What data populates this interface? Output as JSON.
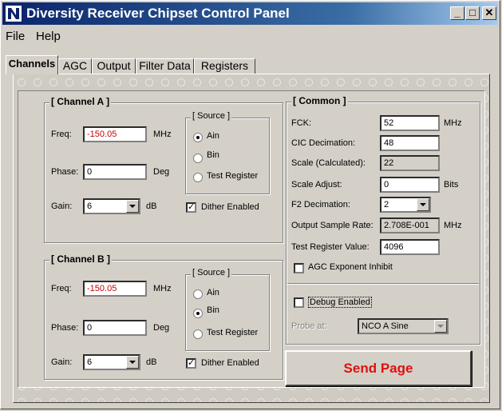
{
  "window": {
    "title": "Diversity Receiver Chipset Control Panel"
  },
  "menu": {
    "file": "File",
    "help": "Help"
  },
  "tabs": [
    "Channels",
    "AGC",
    "Output",
    "Filter Data",
    "Registers"
  ],
  "channel_a": {
    "title": "[ Channel A ]",
    "freq_label": "Freq:",
    "freq_value": "-150.05",
    "freq_unit": "MHz",
    "phase_label": "Phase:",
    "phase_value": "0",
    "phase_unit": "Deg",
    "gain_label": "Gain:",
    "gain_value": "6",
    "gain_unit": "dB",
    "source_title": "[ Source ]",
    "source_options": [
      "Ain",
      "Bin",
      "Test Register"
    ],
    "source_selected": "Ain",
    "dither_label": "Dither Enabled",
    "dither_checked": true
  },
  "channel_b": {
    "title": "[ Channel B ]",
    "freq_label": "Freq:",
    "freq_value": "-150.05",
    "freq_unit": "MHz",
    "phase_label": "Phase:",
    "phase_value": "0",
    "phase_unit": "Deg",
    "gain_label": "Gain:",
    "gain_value": "6",
    "gain_unit": "dB",
    "source_title": "[ Source ]",
    "source_options": [
      "Ain",
      "Bin",
      "Test Register"
    ],
    "source_selected": "Bin",
    "dither_label": "Dither Enabled",
    "dither_checked": true
  },
  "common": {
    "title": "[ Common ]",
    "fck_label": "FCK:",
    "fck_value": "52",
    "fck_unit": "MHz",
    "cic_label": "CIC Decimation:",
    "cic_value": "48",
    "scale_calc_label": "Scale (Calculated):",
    "scale_calc_value": "22",
    "scale_adj_label": "Scale Adjust:",
    "scale_adj_value": "0",
    "scale_adj_unit": "Bits",
    "f2_label": "F2 Decimation:",
    "f2_value": "2",
    "osr_label": "Output Sample Rate:",
    "osr_value": "2.708E-001",
    "osr_unit": "MHz",
    "trv_label": "Test Register Value:",
    "trv_value": "4096",
    "agc_inhibit_label": "AGC Exponent Inhibit",
    "agc_inhibit_checked": false,
    "debug_label": "Debug Enabled",
    "debug_checked": false,
    "probe_label": "Probe at:",
    "probe_value": "NCO A Sine"
  },
  "send_button": "Send Page",
  "colors": {
    "titlebar": "#0a246a",
    "send_text": "#e01010",
    "freq_text": "#cc0000",
    "face": "#d4d0c8"
  }
}
